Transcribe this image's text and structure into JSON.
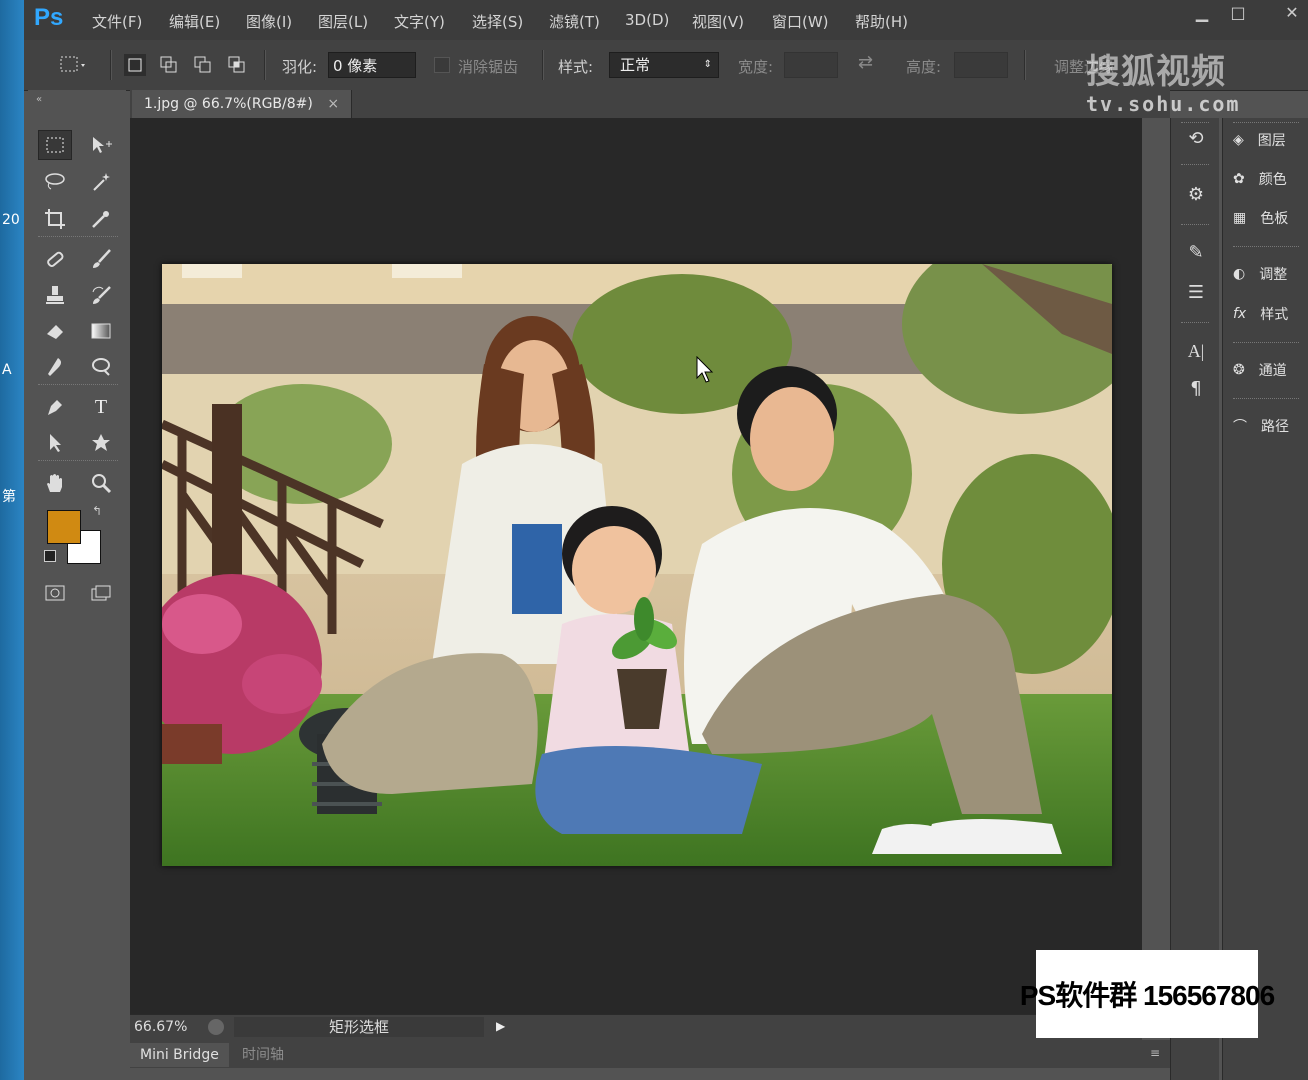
{
  "desktop": {
    "labels": [
      "20",
      "A",
      "第"
    ]
  },
  "app": {
    "logo": "Ps"
  },
  "menu": [
    "文件(F)",
    "编辑(E)",
    "图像(I)",
    "图层(L)",
    "文字(Y)",
    "选择(S)",
    "滤镜(T)",
    "3D(D)",
    "视图(V)",
    "窗口(W)",
    "帮助(H)"
  ],
  "window_controls": {
    "minimize": "▁",
    "maximize": "□",
    "close": "✕"
  },
  "options": {
    "feather_label": "羽化:",
    "feather_value": "0 像素",
    "antialias_label": "消除锯齿",
    "style_label": "样式:",
    "style_value": "正常",
    "width_label": "宽度:",
    "height_label": "高度:",
    "refine_label": "调整边缘"
  },
  "document": {
    "tab_title": "1.jpg @ 66.7%(RGB/8#)",
    "close": "×",
    "zoom": "66.67%",
    "status_info": "矩形选框"
  },
  "bottom_tabs": [
    "Mini Bridge",
    "时间轴"
  ],
  "panels": [
    "图层",
    "颜色",
    "色板",
    "调整",
    "样式",
    "通道",
    "路径"
  ],
  "colors": {
    "foreground": "#d08a12",
    "background": "#ffffff",
    "accent": "#31a8ff"
  },
  "watermark": {
    "brand": "搜狐视频",
    "url": "tv.sohu.com"
  },
  "overlay": {
    "qq_group": "PS软件群 156567806"
  }
}
